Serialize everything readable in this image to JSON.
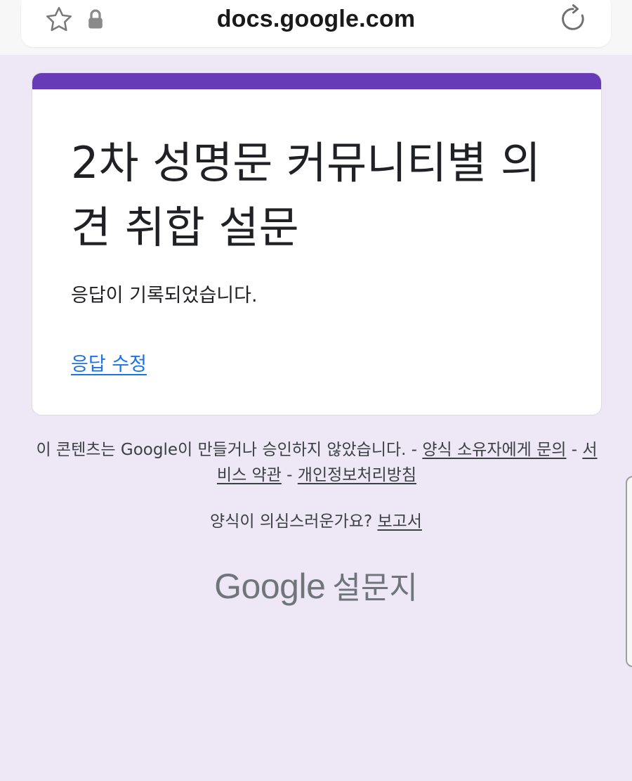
{
  "browser": {
    "url": "docs.google.com",
    "icons": [
      "star-icon",
      "lock-icon",
      "reload-icon"
    ]
  },
  "form": {
    "accent_color": "#673ab7",
    "title": "2차 성명문 커뮤니티별 의견 취합 설문",
    "confirmation": "응답이 기록되었습니다.",
    "edit_response_link": "응답 수정"
  },
  "footer": {
    "disclaimer": "이 콘텐츠는 Google이 만들거나 승인하지 않았습니다.",
    "separator": " - ",
    "contact_owner_link": "양식 소유자에게 문의",
    "terms_link": "서비스 약관",
    "privacy_link": "개인정보처리방침",
    "report_question": "양식이 의심스러운가요?",
    "report_link": "보고서"
  },
  "brand": {
    "google": "Google",
    "forms": "설문지"
  }
}
